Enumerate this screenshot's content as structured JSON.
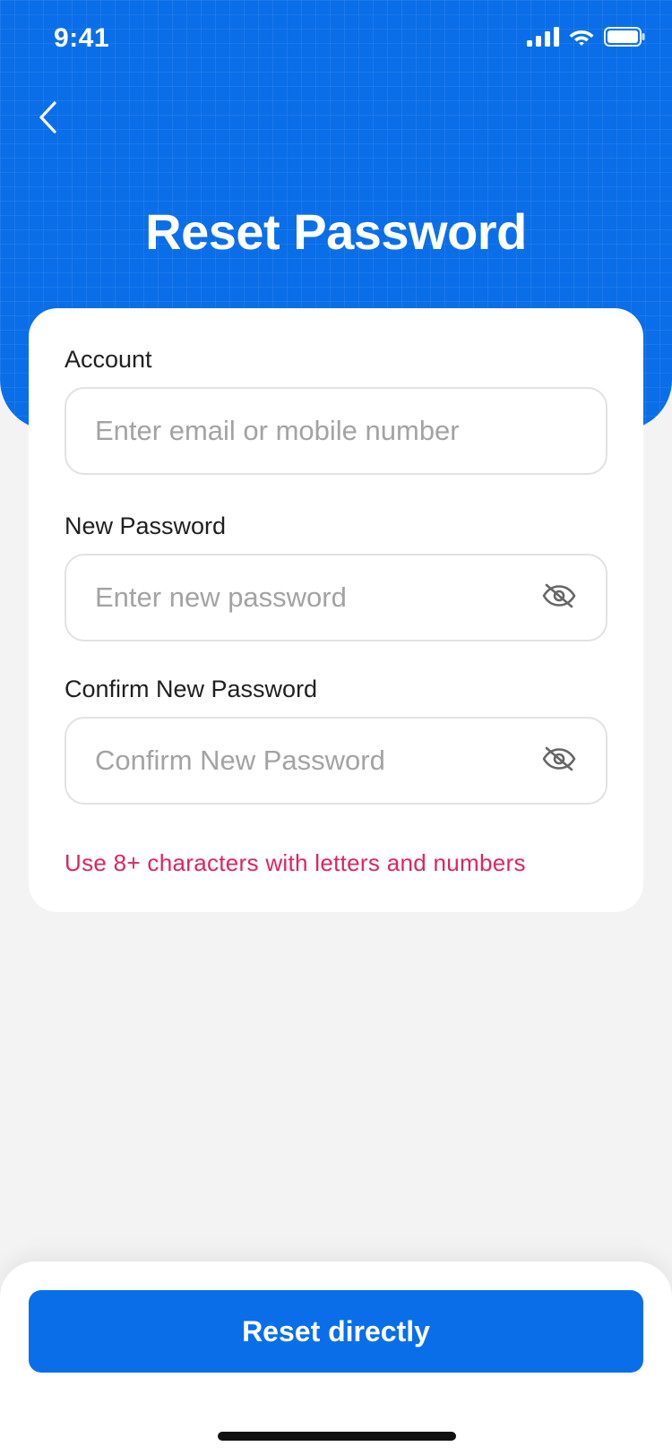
{
  "status_bar": {
    "time": "9:41"
  },
  "header": {
    "title": "Reset Password"
  },
  "form": {
    "account": {
      "label": "Account",
      "placeholder": "Enter email or mobile number",
      "value": ""
    },
    "new_password": {
      "label": "New Password",
      "placeholder": "Enter new password",
      "value": ""
    },
    "confirm_password": {
      "label": "Confirm New Password",
      "placeholder": "Confirm New Password",
      "value": ""
    },
    "hint": "Use 8+ characters with letters and numbers"
  },
  "footer": {
    "reset_label": "Reset directly"
  },
  "colors": {
    "primary": "#0a6ee8",
    "hint": "#e0245e",
    "background": "#f3f3f3"
  },
  "icons": {
    "back": "chevron-left-icon",
    "signal": "cellular-signal-icon",
    "wifi": "wifi-icon",
    "battery": "battery-icon",
    "password_visibility": "eye-off-icon"
  }
}
